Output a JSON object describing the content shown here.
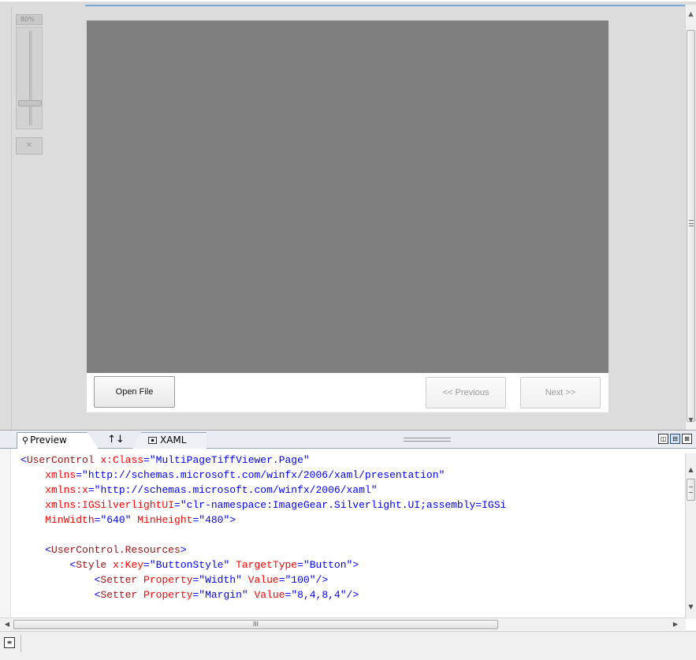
{
  "design_surface": {
    "zoom_label": "80%",
    "zoom_level": 0.8,
    "fit_icon": "fit-to-window-icon",
    "buttons": {
      "open_file": "Open File",
      "previous": "<< Previous",
      "next": "Next >>"
    }
  },
  "tabs": {
    "preview": {
      "label": "Preview",
      "icon": "design-view-icon"
    },
    "swap": {
      "label": "↑↓",
      "icon": "swap-panes-icon"
    },
    "xaml": {
      "label": "XAML",
      "icon": "xaml-file-icon"
    }
  },
  "pane_buttons": {
    "vertical_split": "◫",
    "horizontal_split": "⊟",
    "collapse": "⊠"
  },
  "code_lines": [
    [
      {
        "t": "<",
        "c": "punc"
      },
      {
        "t": "UserControl",
        "c": "tag"
      },
      {
        "t": " x:Class",
        "c": "attr"
      },
      {
        "t": "=",
        "c": "punc"
      },
      {
        "t": "\"MultiPageTiffViewer.Page\"",
        "c": "val"
      }
    ],
    [
      {
        "t": "    xmlns",
        "c": "attr"
      },
      {
        "t": "=",
        "c": "punc"
      },
      {
        "t": "\"http://schemas.microsoft.com/winfx/2006/xaml/presentation\"",
        "c": "val"
      }
    ],
    [
      {
        "t": "    xmlns:x",
        "c": "attr"
      },
      {
        "t": "=",
        "c": "punc"
      },
      {
        "t": "\"http://schemas.microsoft.com/winfx/2006/xaml\"",
        "c": "val"
      }
    ],
    [
      {
        "t": "    xmlns:IGSilverlightUI",
        "c": "attr"
      },
      {
        "t": "=",
        "c": "punc"
      },
      {
        "t": "\"clr-namespace:ImageGear.Silverlight.UI;assembly=IGSi",
        "c": "val"
      }
    ],
    [
      {
        "t": "    MinWidth",
        "c": "attr"
      },
      {
        "t": "=",
        "c": "punc"
      },
      {
        "t": "\"640\"",
        "c": "val"
      },
      {
        "t": " MinHeight",
        "c": "attr"
      },
      {
        "t": "=",
        "c": "punc"
      },
      {
        "t": "\"480\"",
        "c": "val"
      },
      {
        "t": ">",
        "c": "punc"
      }
    ],
    [
      {
        "t": "",
        "c": "punc"
      }
    ],
    [
      {
        "t": "    <",
        "c": "punc"
      },
      {
        "t": "UserControl.Resources",
        "c": "tag"
      },
      {
        "t": ">",
        "c": "punc"
      }
    ],
    [
      {
        "t": "        <",
        "c": "punc"
      },
      {
        "t": "Style",
        "c": "tag"
      },
      {
        "t": " x:Key",
        "c": "attr"
      },
      {
        "t": "=",
        "c": "punc"
      },
      {
        "t": "\"ButtonStyle\"",
        "c": "val"
      },
      {
        "t": " TargetType",
        "c": "attr"
      },
      {
        "t": "=",
        "c": "punc"
      },
      {
        "t": "\"Button\"",
        "c": "val"
      },
      {
        "t": ">",
        "c": "punc"
      }
    ],
    [
      {
        "t": "            <",
        "c": "punc"
      },
      {
        "t": "Setter",
        "c": "tag"
      },
      {
        "t": " Property",
        "c": "attr"
      },
      {
        "t": "=",
        "c": "punc"
      },
      {
        "t": "\"Width\"",
        "c": "val"
      },
      {
        "t": " Value",
        "c": "attr"
      },
      {
        "t": "=",
        "c": "punc"
      },
      {
        "t": "\"100\"",
        "c": "val"
      },
      {
        "t": "/>",
        "c": "punc"
      }
    ],
    [
      {
        "t": "            <",
        "c": "punc"
      },
      {
        "t": "Setter",
        "c": "tag"
      },
      {
        "t": " Property",
        "c": "attr"
      },
      {
        "t": "=",
        "c": "punc"
      },
      {
        "t": "\"Margin\"",
        "c": "val"
      },
      {
        "t": " Value",
        "c": "attr"
      },
      {
        "t": "=",
        "c": "punc"
      },
      {
        "t": "\"8,4,8,4\"",
        "c": "val"
      },
      {
        "t": "/>",
        "c": "punc"
      }
    ]
  ],
  "scrollbars": {
    "hscroll_grip": "III"
  },
  "status": {
    "icon": "document-outline-icon"
  },
  "colors": {
    "canvas": "#7f7f7f",
    "design_background": "#dcdcdc",
    "xml_tag": "#a31515",
    "xml_attribute": "#ff0000",
    "xml_value": "#0000ff"
  }
}
